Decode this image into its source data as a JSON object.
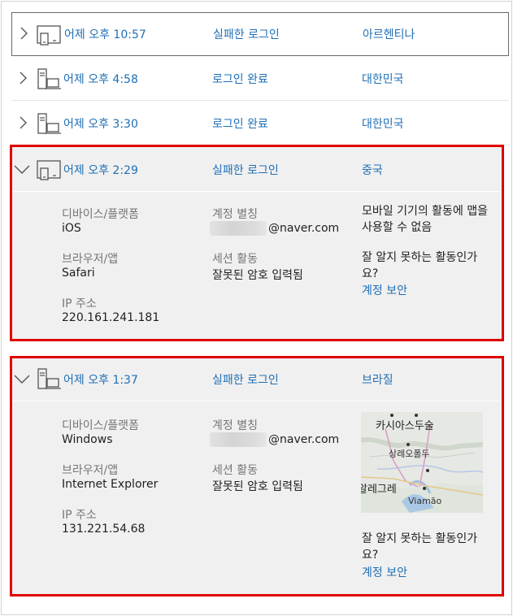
{
  "rows": [
    {
      "time": "어제 오후 10:57",
      "event": "실패한 로그인",
      "country": "아르헨티나",
      "device": "tablet-phone-icon"
    },
    {
      "time": "어제 오후 4:58",
      "event": "로그인 완료",
      "country": "대한민국",
      "device": "desktop-laptop-icon"
    },
    {
      "time": "어제 오후 3:30",
      "event": "로그인 완료",
      "country": "대한민국",
      "device": "desktop-laptop-icon"
    }
  ],
  "expanded": [
    {
      "time": "어제 오후 2:29",
      "event": "실패한 로그인",
      "country": "중국",
      "device": "tablet-phone-icon",
      "device_label": "디바이스/플랫폼",
      "device_value": "iOS",
      "browser_label": "브라우저/앱",
      "browser_value": "Safari",
      "ip_label": "IP 주소",
      "ip_value": "220.161.241.181",
      "alias_label": "계정 별칭",
      "alias_suffix": "@naver.com",
      "session_label": "세션 활동",
      "session_value": "잘못된 암호 입력됨",
      "mobile_note": "모바일 기기의 활동에 맵을 사용할 수 없음",
      "unfamiliar": "잘 알지 못하는 활동인가요?",
      "secure_link": "계정 보안"
    },
    {
      "time": "어제 오후 1:37",
      "event": "실패한 로그인",
      "country": "브라질",
      "device": "desktop-laptop-icon",
      "device_label": "디바이스/플랫폼",
      "device_value": "Windows",
      "browser_label": "브라우저/앱",
      "browser_value": "Internet Explorer",
      "ip_label": "IP 주소",
      "ip_value": "131.221.54.68",
      "alias_label": "계정 별칭",
      "alias_suffix": "@naver.com",
      "session_label": "세션 활동",
      "session_value": "잘못된 암호 입력됨",
      "unfamiliar": "잘 알지 못하는 활동인가요?",
      "secure_link": "계정 보안",
      "map": {
        "city_1": "카시아스두술",
        "city_2": "상레오폴두",
        "city_3": "알레그레",
        "city_4": "Viamão"
      }
    }
  ],
  "colors": {
    "link": "#1f6fb5",
    "highlight": "#e00000",
    "panel_bg": "#f0f0f0"
  }
}
